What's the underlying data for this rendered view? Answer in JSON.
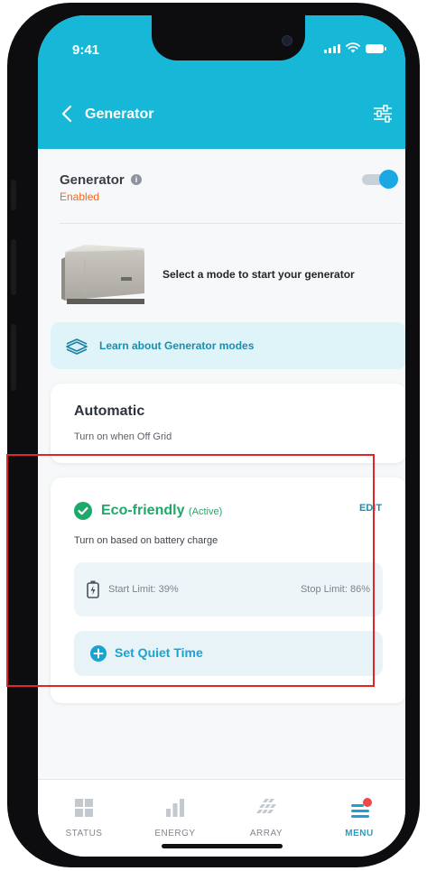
{
  "status_bar": {
    "time": "9:41"
  },
  "header": {
    "title": "Generator",
    "back_icon": "chevron-left-icon",
    "filter_icon": "sliders-icon"
  },
  "generator": {
    "title": "Generator",
    "info_glyph": "i",
    "status": "Enabled",
    "toggle_on": true,
    "prompt": "Select a mode to start your generator"
  },
  "learn": {
    "label": "Learn about Generator modes",
    "icon": "book-stack-icon"
  },
  "modes": {
    "automatic": {
      "title": "Automatic",
      "description": "Turn on when Off Grid"
    },
    "eco": {
      "title": "Eco-friendly",
      "active_tag": "(Active)",
      "edit_label": "EDIT",
      "description": "Turn on based on battery charge",
      "start_limit": "Start Limit: 39%",
      "stop_limit": "Stop Limit: 86%",
      "quiet_time_label": "Set Quiet Time"
    }
  },
  "tabs": [
    {
      "label": "STATUS",
      "icon": "grid-icon",
      "active": false
    },
    {
      "label": "ENERGY",
      "icon": "bar-chart-icon",
      "active": false
    },
    {
      "label": "ARRAY",
      "icon": "solar-panel-icon",
      "active": false
    },
    {
      "label": "MENU",
      "icon": "menu-icon",
      "active": true
    }
  ],
  "colors": {
    "header": "#17b7d8",
    "accent": "#1aa3d0",
    "eco_green": "#1ea86a",
    "enabled_orange": "#f06a1e",
    "highlight_border": "#e1262a"
  }
}
